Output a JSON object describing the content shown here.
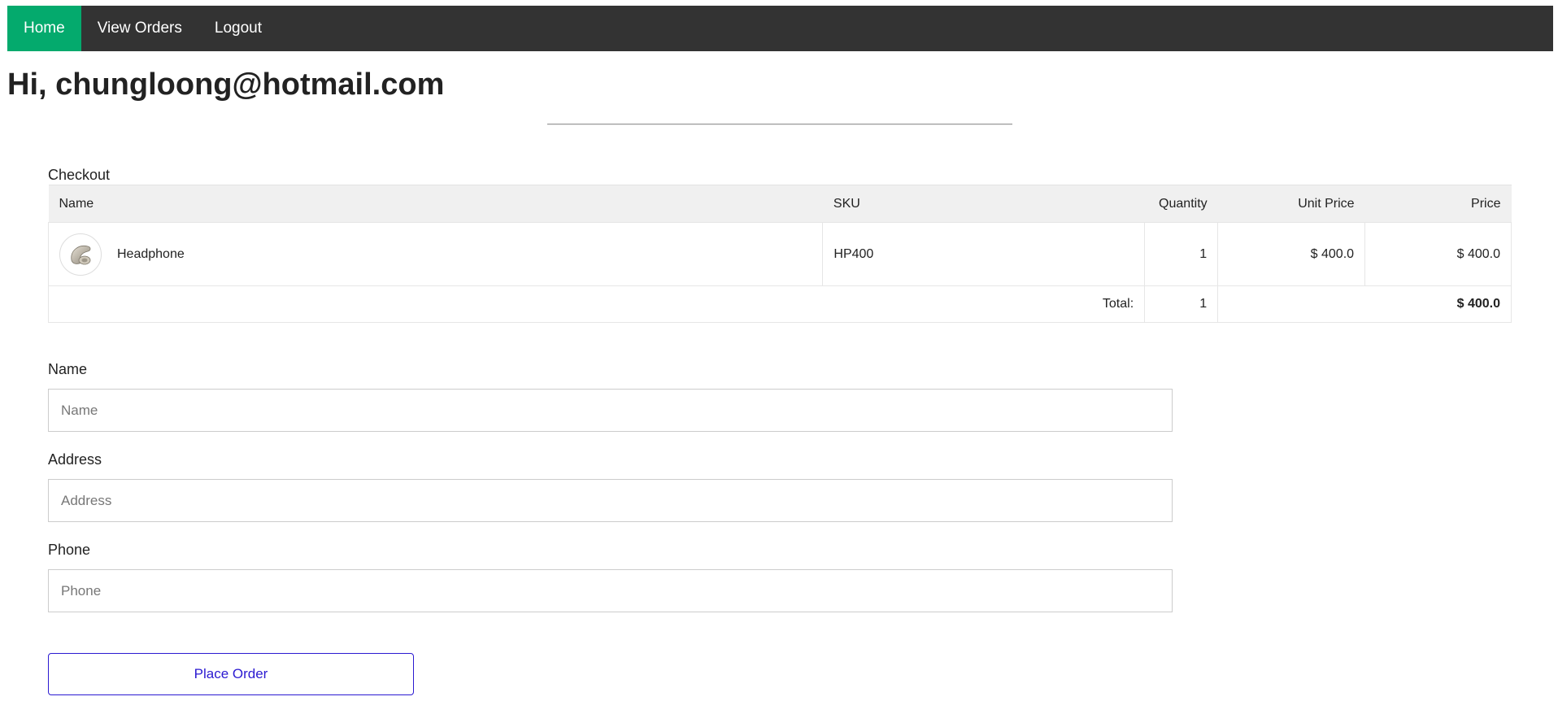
{
  "nav": {
    "items": [
      {
        "label": "Home",
        "active": true
      },
      {
        "label": "View Orders",
        "active": false
      },
      {
        "label": "Logout",
        "active": false
      }
    ],
    "active_color": "#04aa6d",
    "bar_color": "#333333"
  },
  "greeting": "Hi, chungloong@hotmail.com",
  "checkout": {
    "caption": "Checkout",
    "headers": {
      "name": "Name",
      "sku": "SKU",
      "quantity": "Quantity",
      "unit_price": "Unit Price",
      "price": "Price"
    },
    "items": [
      {
        "icon": "headphone-icon",
        "name": "Headphone",
        "sku": "HP400",
        "quantity": "1",
        "unit_price": "$ 400.0",
        "price": "$ 400.0"
      }
    ],
    "total": {
      "label": "Total:",
      "quantity": "1",
      "price": "$ 400.0"
    }
  },
  "form": {
    "name": {
      "label": "Name",
      "placeholder": "Name",
      "value": ""
    },
    "address": {
      "label": "Address",
      "placeholder": "Address",
      "value": ""
    },
    "phone": {
      "label": "Phone",
      "placeholder": "Phone",
      "value": ""
    },
    "submit_label": "Place Order",
    "submit_color": "#2b1ad1"
  }
}
